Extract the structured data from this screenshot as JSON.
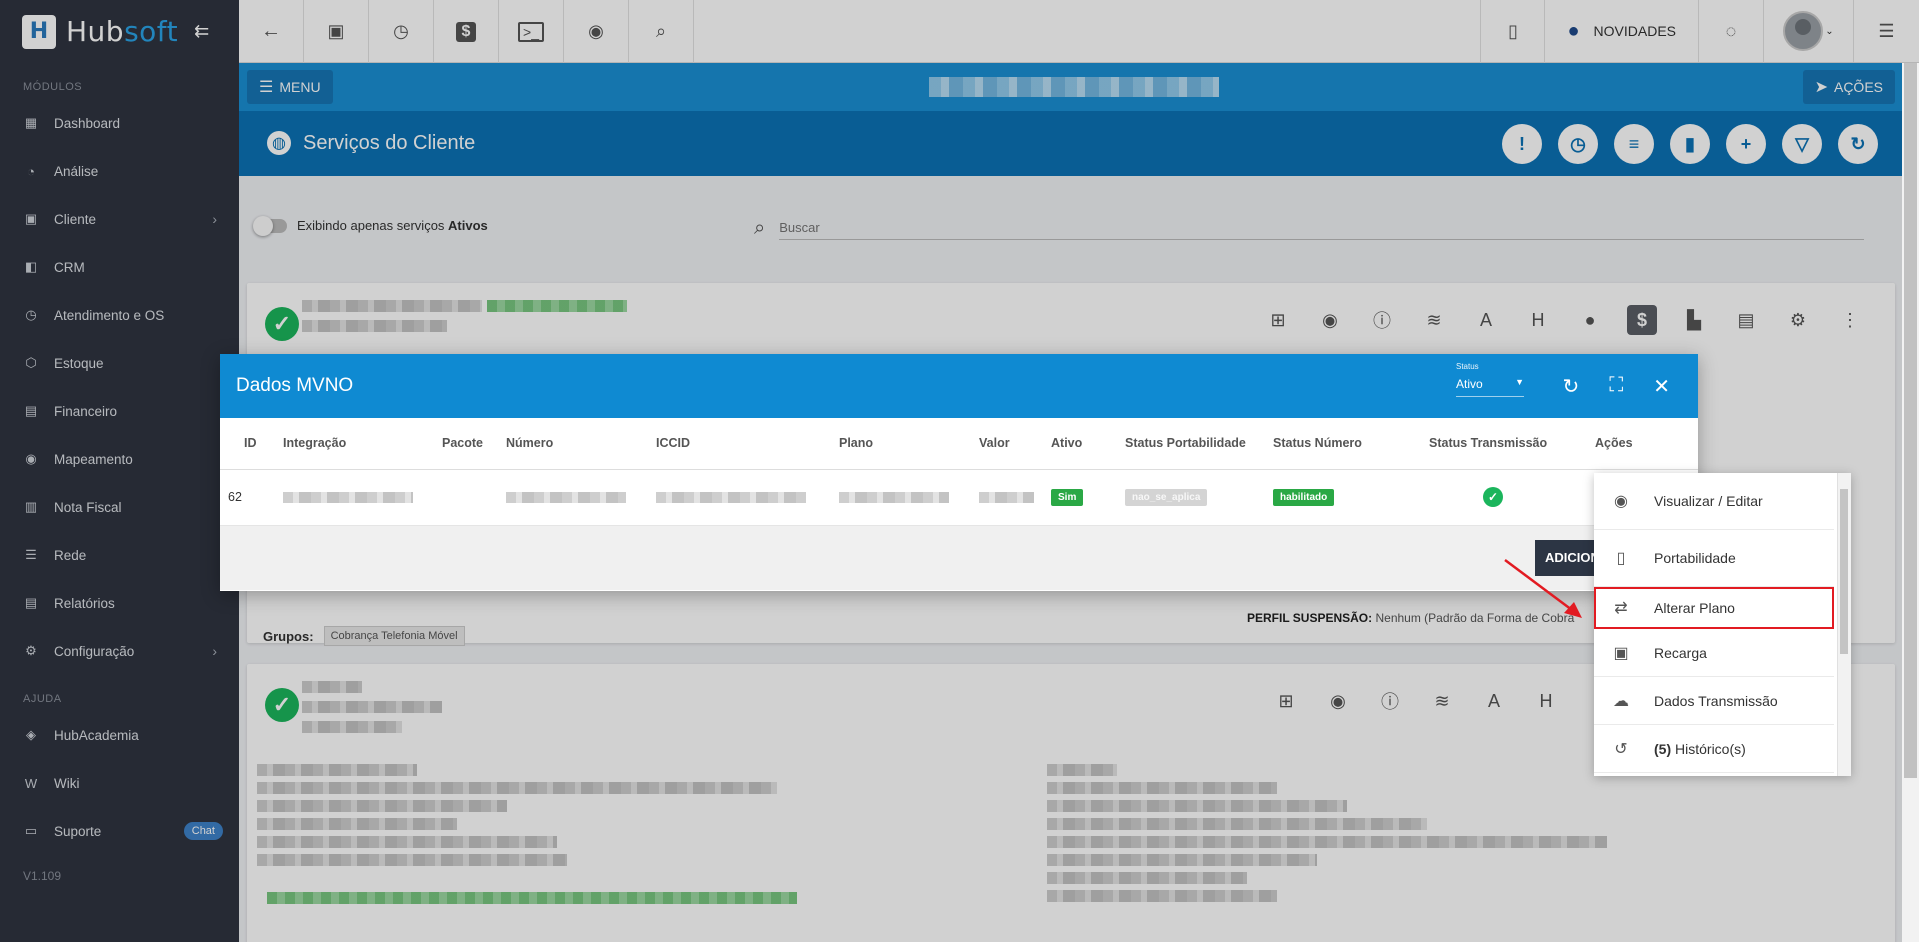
{
  "brand": {
    "name_a": "Hub",
    "name_b": "soft"
  },
  "sidebar": {
    "section_modules": "MÓDULOS",
    "items": [
      {
        "label": "Dashboard"
      },
      {
        "label": "Análise"
      },
      {
        "label": "Cliente"
      },
      {
        "label": "CRM"
      },
      {
        "label": "Atendimento e OS"
      },
      {
        "label": "Estoque"
      },
      {
        "label": "Financeiro"
      },
      {
        "label": "Mapeamento"
      },
      {
        "label": "Nota Fiscal"
      },
      {
        "label": "Rede"
      },
      {
        "label": "Relatórios"
      },
      {
        "label": "Configuração"
      }
    ],
    "section_help": "AJUDA",
    "help_items": [
      {
        "label": "HubAcademia"
      },
      {
        "label": "Wiki"
      },
      {
        "label": "Suporte",
        "badge": "Chat"
      }
    ],
    "version": "V1.109"
  },
  "topbar": {
    "novidades": "NOVIDADES"
  },
  "bluebar": {
    "menu": "MENU",
    "acoes": "AÇÕES"
  },
  "page": {
    "title": "Serviços do Cliente",
    "toggle_label": "Exibindo apenas serviços ",
    "toggle_label_bold": "Ativos",
    "search_placeholder": "Buscar",
    "grupos_label": "Grupos:",
    "grupos_tag": "Cobrança Telefonia Móvel",
    "perfil_label": "PERFIL SUSPENSÃO:",
    "perfil_value": " Nenhum (Padrão da Forma de Cobra"
  },
  "modal": {
    "title": "Dados MVNO",
    "status_label": "Status",
    "status_value": "Ativo",
    "columns": [
      "ID",
      "Integração",
      "Pacote",
      "Número",
      "ICCID",
      "Plano",
      "Valor",
      "Ativo",
      "Status Portabilidade",
      "Status Número",
      "Status Transmissão",
      "Ações"
    ],
    "row": {
      "id": "62",
      "ativo": "Sim",
      "status_portabilidade": "nao_se_aplica",
      "status_numero": "habilitado"
    },
    "add_button": "ADICIONAR"
  },
  "context_menu": {
    "items": [
      {
        "label": "Visualizar / Editar"
      },
      {
        "label": "Portabilidade"
      },
      {
        "label": "Alterar Plano"
      },
      {
        "label": "Recarga"
      },
      {
        "label": "Dados Transmissão"
      }
    ],
    "history_count": "(5)",
    "history_label": " Histórico(s)"
  },
  "colors": {
    "primary": "#0f8ad2",
    "sidebar": "#2f3440",
    "success": "#1bb55c",
    "highlight": "#e21b22"
  }
}
